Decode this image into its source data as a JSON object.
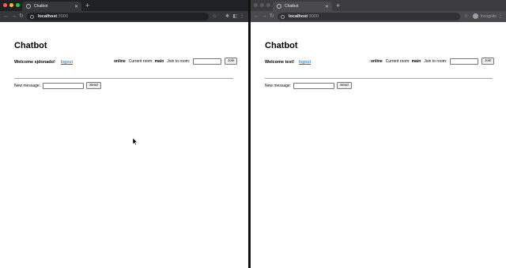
{
  "left_window": {
    "tab_title": "Chatbot",
    "url_host": "localhost",
    "url_port": ":3000",
    "page": {
      "title": "Chatbot",
      "welcome": "Welcome sjdonado!",
      "logout": "logout",
      "status": "online",
      "current_room_label": "Current room:",
      "current_room": "main",
      "join_label": "Join to room:",
      "join_button": "Join",
      "message_label": "New message:",
      "send_button": "Send"
    }
  },
  "right_window": {
    "tab_title": "Chatbot",
    "url_host": "localhost",
    "url_port": ":3000",
    "incognito_label": "Incognito",
    "page": {
      "title": "Chatbot",
      "welcome": "Welcome test!",
      "logout": "logout",
      "status": "online",
      "current_room_label": "Current room:",
      "current_room": "main",
      "join_label": "Join to room:",
      "join_button": "Join",
      "message_label": "New message:",
      "send_button": "Send"
    }
  },
  "colors": {
    "link": "#0066cc",
    "traffic_red": "#ff5f57",
    "traffic_yellow": "#febc2e",
    "traffic_green": "#28c840",
    "traffic_inactive": "#5a5a5d"
  },
  "icons": [
    "back-icon",
    "forward-icon",
    "reload-icon",
    "info-icon",
    "star-icon",
    "extension-icon",
    "menu-icon",
    "incognito-icon",
    "mouse-cursor-icon"
  ]
}
